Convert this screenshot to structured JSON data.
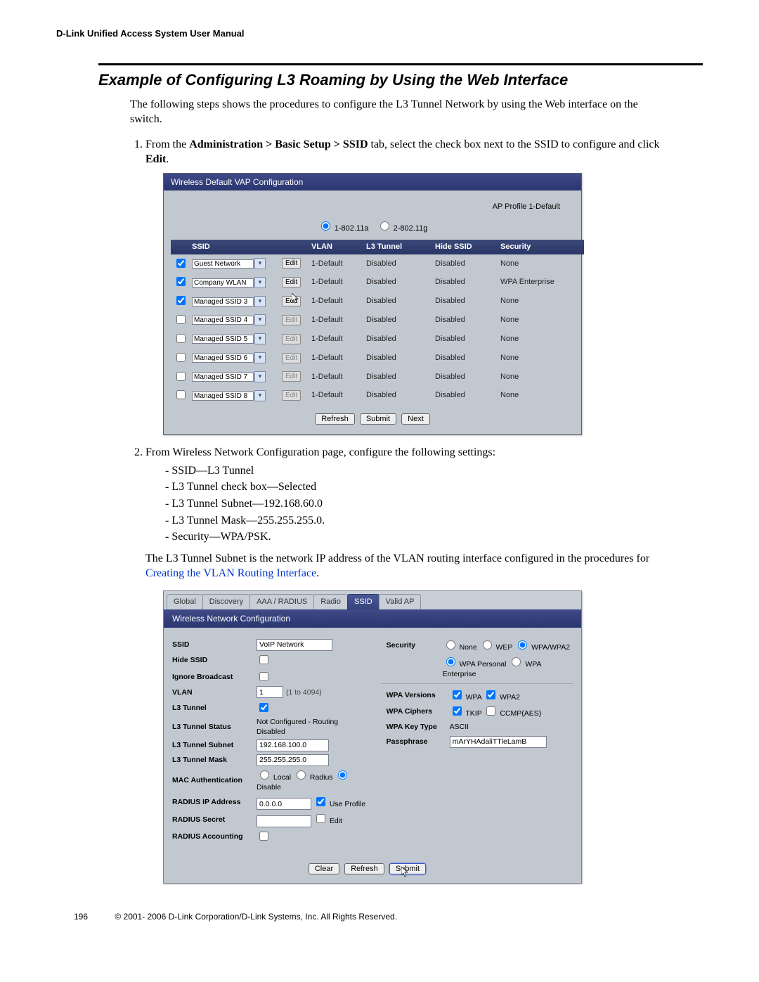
{
  "header": {
    "manual_title": "D-Link Unified Access System User Manual"
  },
  "section": {
    "title": "Example of Configuring L3 Roaming by Using the Web Interface",
    "intro": "The following steps shows the procedures to configure the L3 Tunnel Network by using the Web interface on the switch.",
    "step1_pre": "From the ",
    "step1_nav": "Administration > Basic Setup > SSID",
    "step1_post": " tab, select the check box next to the SSID to configure and click ",
    "step1_edit": "Edit",
    "step1_end": ".",
    "step2_intro": "From Wireless Network Configuration page, configure the following settings:",
    "step2_items": [
      "SSID—L3 Tunnel",
      "L3 Tunnel check box—Selected",
      "L3 Tunnel Subnet—192.168.60.0",
      "L3 Tunnel Mask—255.255.255.0.",
      "Security—WPA/PSK."
    ],
    "step2_para_pre": "The L3 Tunnel Subnet is the network IP address of the VLAN routing interface configured in the procedures for ",
    "step2_link": "Creating the VLAN Routing Interface",
    "step2_para_post": "."
  },
  "footer": {
    "page": "196",
    "copyright": "© 2001- 2006 D-Link Corporation/D-Link Systems, Inc. All Rights Reserved."
  },
  "ss1": {
    "title": "Wireless Default VAP Configuration",
    "profile": "AP Profile 1-Default",
    "radio1": "1-802.11a",
    "radio2": "2-802.11g",
    "headers": {
      "ssid": "SSID",
      "vlan": "VLAN",
      "l3": "L3 Tunnel",
      "hide": "Hide SSID",
      "sec": "Security"
    },
    "rows": [
      {
        "checked": true,
        "enabled": true,
        "ssid": "Guest Network",
        "vlan": "1-Default",
        "l3": "Disabled",
        "hide": "Disabled",
        "sec": "None"
      },
      {
        "checked": true,
        "enabled": true,
        "ssid": "Company WLAN",
        "vlan": "1-Default",
        "l3": "Disabled",
        "hide": "Disabled",
        "sec": "WPA Enterprise"
      },
      {
        "checked": true,
        "enabled": true,
        "ssid": "Managed SSID 3",
        "vlan": "1-Default",
        "l3": "Disabled",
        "hide": "Disabled",
        "sec": "None",
        "cursor": true
      },
      {
        "checked": false,
        "enabled": false,
        "ssid": "Managed SSID 4",
        "vlan": "1-Default",
        "l3": "Disabled",
        "hide": "Disabled",
        "sec": "None"
      },
      {
        "checked": false,
        "enabled": false,
        "ssid": "Managed SSID 5",
        "vlan": "1-Default",
        "l3": "Disabled",
        "hide": "Disabled",
        "sec": "None"
      },
      {
        "checked": false,
        "enabled": false,
        "ssid": "Managed SSID 6",
        "vlan": "1-Default",
        "l3": "Disabled",
        "hide": "Disabled",
        "sec": "None"
      },
      {
        "checked": false,
        "enabled": false,
        "ssid": "Managed SSID 7",
        "vlan": "1-Default",
        "l3": "Disabled",
        "hide": "Disabled",
        "sec": "None"
      },
      {
        "checked": false,
        "enabled": false,
        "ssid": "Managed SSID 8",
        "vlan": "1-Default",
        "l3": "Disabled",
        "hide": "Disabled",
        "sec": "None"
      }
    ],
    "buttons": {
      "refresh": "Refresh",
      "submit": "Submit",
      "next": "Next",
      "edit": "Edit"
    }
  },
  "ss2": {
    "tabs": [
      "Global",
      "Discovery",
      "AAA / RADIUS",
      "Radio",
      "SSID",
      "Valid AP"
    ],
    "active_tab": 4,
    "title": "Wireless Network Configuration",
    "left": {
      "ssid_label": "SSID",
      "ssid_value": "VoIP Network",
      "hide_label": "Hide SSID",
      "ignore_label": "Ignore Broadcast",
      "vlan_label": "VLAN",
      "vlan_value": "1",
      "vlan_note": "(1 to 4094)",
      "l3_label": "L3 Tunnel",
      "l3status_label": "L3 Tunnel Status",
      "l3status_value": "Not Configured - Routing Disabled",
      "l3subnet_label": "L3 Tunnel Subnet",
      "l3subnet_value": "192.168.100.0",
      "l3mask_label": "L3 Tunnel Mask",
      "l3mask_value": "255.255.255.0",
      "macauth_label": "MAC Authentication",
      "macauth_local": "Local",
      "macauth_radius": "Radius",
      "macauth_disable": "Disable",
      "radiusip_label": "RADIUS IP Address",
      "radiusip_value": "0.0.0.0",
      "use_profile": "Use Profile",
      "radiussecret_label": "RADIUS Secret",
      "secret_edit": "Edit",
      "radiusacct_label": "RADIUS Accounting"
    },
    "right": {
      "sec_label": "Security",
      "sec_none": "None",
      "sec_wep": "WEP",
      "sec_wpa": "WPA/WPA2",
      "sec_personal": "WPA Personal",
      "sec_enterprise": "WPA Enterprise",
      "ver_label": "WPA Versions",
      "ver_wpa": "WPA",
      "ver_wpa2": "WPA2",
      "cipher_label": "WPA Ciphers",
      "cipher_tkip": "TKIP",
      "cipher_ccmp": "CCMP(AES)",
      "keytype_label": "WPA Key Type",
      "keytype_value": "ASCII",
      "pass_label": "Passphrase",
      "pass_value": "mArYHAdaliTTleLamB"
    },
    "buttons": {
      "clear": "Clear",
      "refresh": "Refresh",
      "submit": "Submit"
    }
  }
}
